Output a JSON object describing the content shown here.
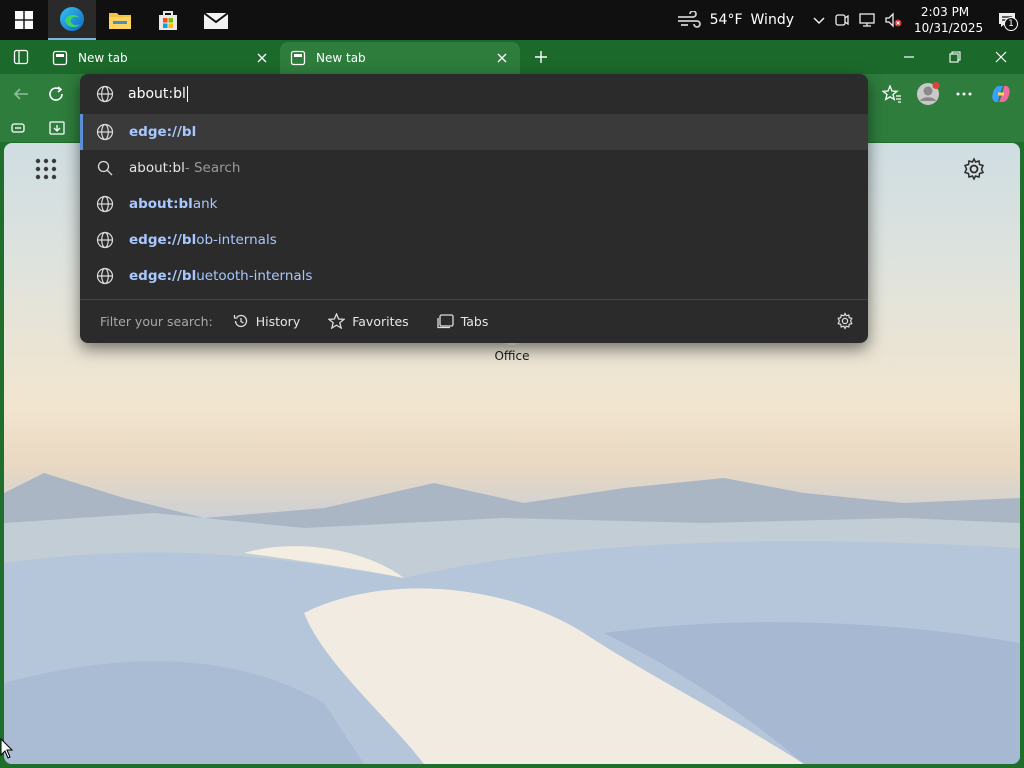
{
  "taskbar": {
    "weather": {
      "temp": "54°F",
      "condition": "Windy"
    },
    "clock": {
      "time": "2:03 PM",
      "date": "10/31/2025"
    },
    "notifications_count": "1"
  },
  "browser": {
    "tabs": [
      {
        "label": "New tab"
      },
      {
        "label": "New tab"
      }
    ],
    "accent": "#2e7d3d"
  },
  "omnibox": {
    "typed": "about:bl",
    "suggestions": [
      {
        "bold": "edge://bl",
        "rest": "",
        "icon": "globe-icon"
      },
      {
        "plain": "about:bl",
        "hint": " - Search",
        "icon": "search-icon"
      },
      {
        "bold": "about:bl",
        "rest": "ank",
        "icon": "globe-icon"
      },
      {
        "bold": "edge://bl",
        "rest": "ob-internals",
        "icon": "globe-icon"
      },
      {
        "bold": "edge://bl",
        "rest": "uetooth-internals",
        "icon": "globe-icon"
      }
    ],
    "filter_label": "Filter your search:",
    "filters": [
      "History",
      "Favorites",
      "Tabs"
    ]
  },
  "ntp": {
    "tile_label": "Office"
  }
}
